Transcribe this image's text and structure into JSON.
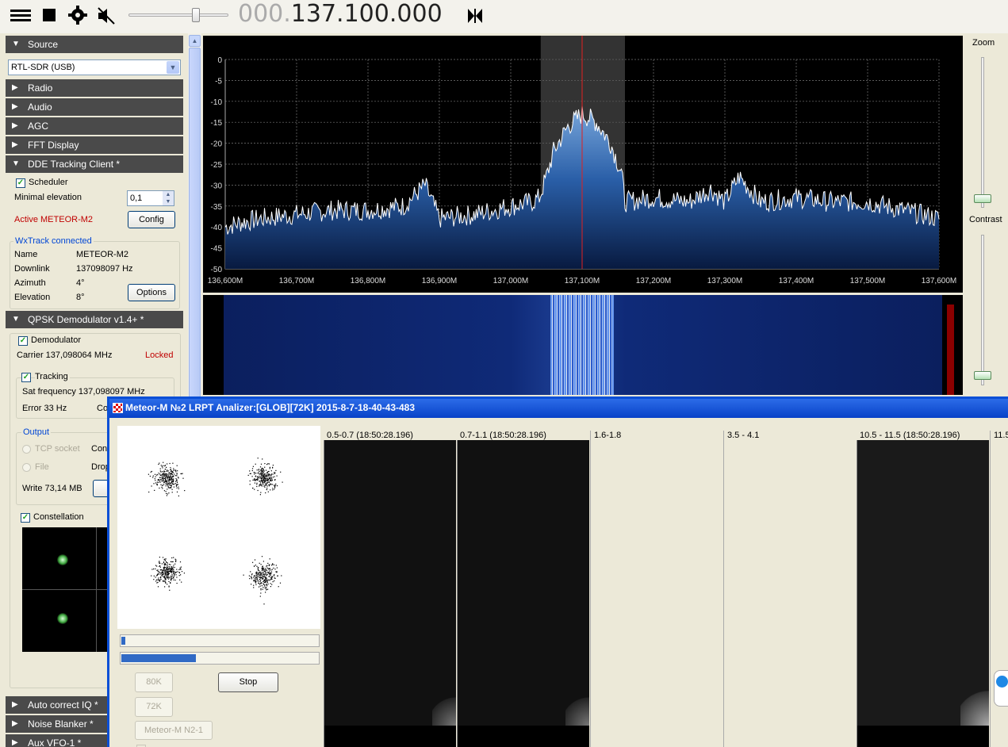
{
  "toolbar": {
    "frequency_dim": "000.",
    "frequency_main": "137.100.000",
    "icons": [
      "menu-icon",
      "stop-icon",
      "settings-icon",
      "mute-icon",
      "volume-slider",
      "swap-icon"
    ]
  },
  "left": {
    "source_header": "Source",
    "source_value": "RTL-SDR (USB)",
    "radio": "Radio",
    "audio": "Audio",
    "agc": "AGC",
    "fft": "FFT Display",
    "dde": "DDE Tracking Client *",
    "scheduler": "Scheduler",
    "min_elev_label": "Minimal elevation",
    "min_elev_value": "0,1",
    "active": "Active METEOR-M2",
    "config": "Config",
    "wx_title": "WxTrack connected",
    "name_label": "Name",
    "name_value": "METEOR-M2",
    "downlink_label": "Downlink",
    "downlink_value": "137098097 Hz",
    "azimuth_label": "Azimuth",
    "azimuth_value": "4°",
    "elevation_label": "Elevation",
    "elevation_value": "8°",
    "options": "Options",
    "qpsk": "QPSK Demodulator v1.4+ *",
    "demodulator": "Demodulator",
    "carrier": "Carrier 137,098064 MHz",
    "locked": "Locked",
    "tracking": "Tracking",
    "sat_freq": "Sat frequency 137,098097 MHz",
    "error": "Error 33 Hz",
    "error_trunc": "Co",
    "output_title": "Output",
    "tcp": "TCP socket",
    "tcp_trunc": "Con",
    "file": "File",
    "file_trunc": "Drop",
    "write": "Write 73,14 MB",
    "constellation": "Constellation",
    "auto_iq": "Auto correct IQ *",
    "noise": "Noise Blanker *",
    "aux": "Aux VFO-1 *"
  },
  "right": {
    "zoom": "Zoom",
    "contrast": "Contrast"
  },
  "chart_data": {
    "type": "line",
    "title": "",
    "xlabel": "",
    "ylabel": "",
    "x_ticks": [
      "136,600M",
      "136,700M",
      "136,800M",
      "136,900M",
      "137,000M",
      "137,100M",
      "137,200M",
      "137,300M",
      "137,400M",
      "137,500M",
      "137,600M"
    ],
    "y_ticks": [
      0,
      -5,
      -10,
      -15,
      -20,
      -25,
      -30,
      -35,
      -40,
      -45,
      -50
    ],
    "ylim": [
      -50,
      0
    ],
    "xlim": [
      136.6,
      137.6
    ],
    "center": 137.1,
    "filter_band": [
      137.042,
      137.16
    ],
    "series": [
      {
        "x": [
          136.6,
          136.62,
          136.65,
          136.7,
          136.75,
          136.8,
          136.85,
          136.88,
          136.9,
          136.95,
          137.0,
          137.03,
          137.04,
          137.05,
          137.06,
          137.08,
          137.1,
          137.12,
          137.14,
          137.155,
          137.16,
          137.2,
          137.25,
          137.28,
          137.3,
          137.32,
          137.35,
          137.4,
          137.45,
          137.5,
          137.55,
          137.6
        ],
        "values": [
          -40,
          -39,
          -38,
          -37,
          -36,
          -36,
          -35,
          -30,
          -38,
          -37,
          -35,
          -34,
          -33,
          -28,
          -22,
          -16,
          -13,
          -15,
          -20,
          -27,
          -34,
          -33,
          -34,
          -31,
          -34,
          -28,
          -34,
          -33,
          -34,
          -34,
          -36,
          -38
        ]
      }
    ]
  },
  "analyzer": {
    "title": "Meteor-M №2 LRPT Analizer:[GLOB][72K] 2015-8-7-18-40-43-483",
    "btn_80k": "80K",
    "btn_72k": "72K",
    "btn_stop": "Stop",
    "btn_meteor": "Meteor-M N2-1",
    "progress1": 0.02,
    "progress2": 0.38,
    "channels": [
      "0.5-0.7 (18:50:28.196)",
      "0.7-1.1 (18:50:28.196)",
      "1.6-1.8",
      "3.5 - 4.1",
      "10.5 - 11.5 (18:50:28.196)",
      "11.5"
    ]
  }
}
